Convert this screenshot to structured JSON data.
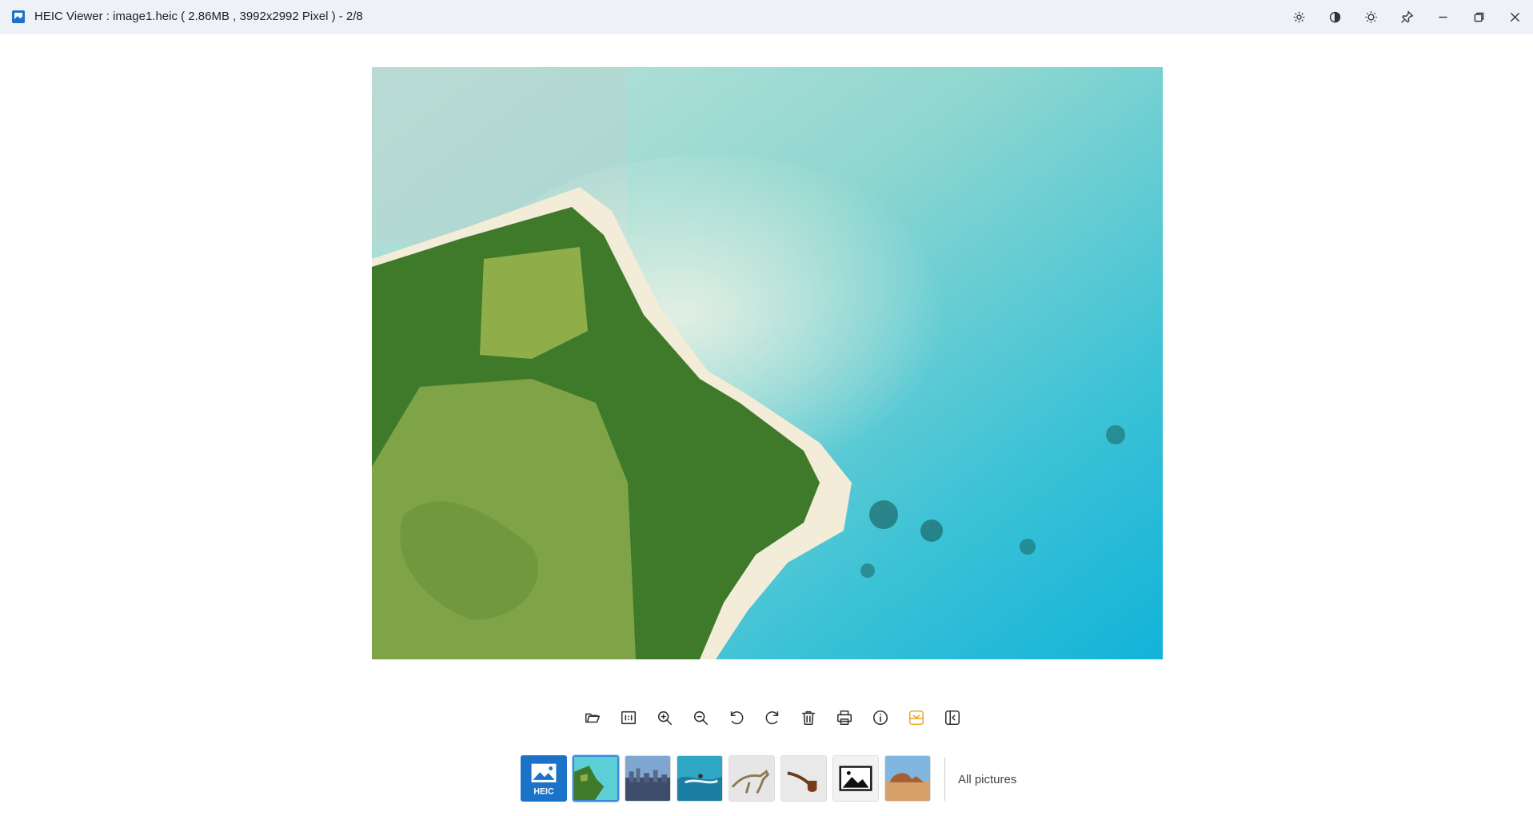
{
  "window": {
    "title": "HEIC Viewer : image1.heic ( 2.86MB , 3992x2992 Pixel ) - 2/8",
    "buttons": [
      "settings-icon",
      "theme-icon",
      "brightness-icon",
      "pin-icon",
      "minimize-icon",
      "restore-icon",
      "close-icon"
    ]
  },
  "viewer": {
    "image_name": "image1.heic",
    "position": "2/8"
  },
  "toolbar": {
    "tools": [
      "open-folder-icon",
      "actual-size-icon",
      "zoom-in-icon",
      "zoom-out-icon",
      "rotate-left-icon",
      "rotate-right-icon",
      "delete-icon",
      "print-icon",
      "info-icon",
      "thumbnail-toggle-icon",
      "sidebar-toggle-icon"
    ],
    "active_color": "#e8a92e"
  },
  "thumbnails": {
    "items": [
      "heic-format",
      "island-aerial",
      "city-skyline",
      "surfer",
      "dinosaur",
      "pipe",
      "placeholder-image",
      "desert-rocks"
    ],
    "selected_index": 1,
    "heic_label": "HEIC",
    "all_pictures_label": "All pictures"
  },
  "colors": {
    "titlebar": "#eef1f8",
    "accent": "#1a73c9",
    "selection": "#3a88d8"
  }
}
